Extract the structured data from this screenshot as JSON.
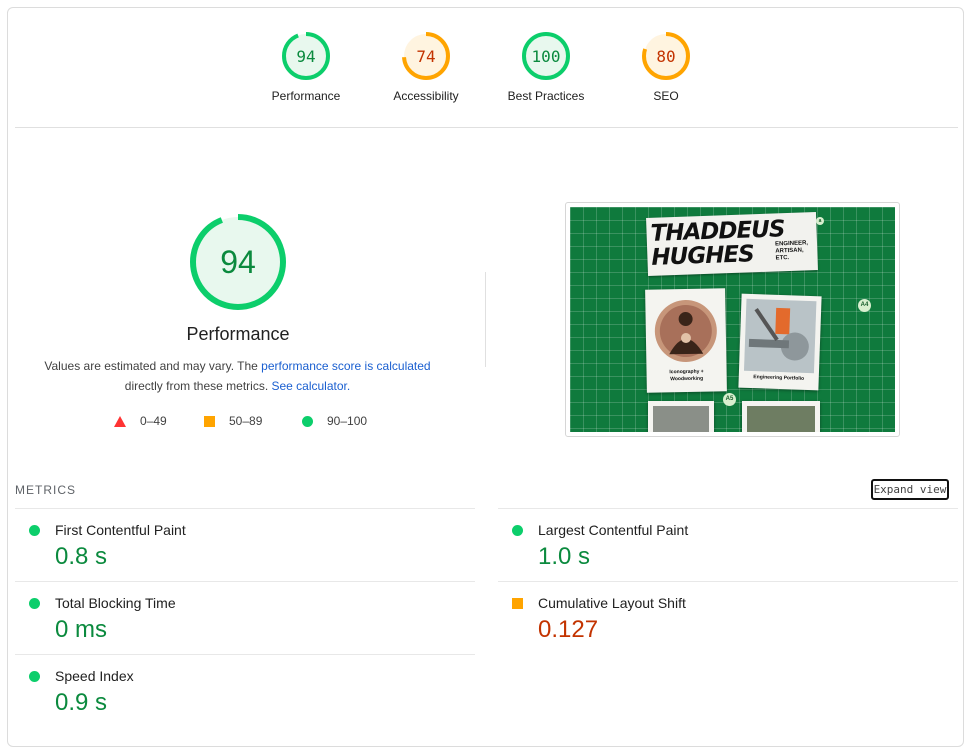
{
  "categories": [
    {
      "label": "Performance",
      "score": "94",
      "value": 94,
      "color": "#0cce6b",
      "text_color": "#0b8a3e",
      "fill": "#e8f8ee"
    },
    {
      "label": "Accessibility",
      "score": "74",
      "value": 74,
      "color": "#ffa400",
      "text_color": "#c33300",
      "fill": "#fff4e0"
    },
    {
      "label": "Best Practices",
      "score": "100",
      "value": 100,
      "color": "#0cce6b",
      "text_color": "#0b8a3e",
      "fill": "#e8f8ee"
    },
    {
      "label": "SEO",
      "score": "80",
      "value": 80,
      "color": "#ffa400",
      "text_color": "#c33300",
      "fill": "#fff4e0"
    }
  ],
  "main": {
    "score": "94",
    "value": 94,
    "title": "Performance",
    "desc_prefix": "Values are estimated and may vary. The ",
    "desc_link": "performance score is calculated",
    "desc_middle": " directly from these metrics. ",
    "calc_link": "See calculator.",
    "legend": {
      "fail": "0–49",
      "average": "50–89",
      "pass": "90–100"
    }
  },
  "screenshot": {
    "name_line1": "THADDEUS",
    "name_line2": "HUGHES",
    "tagline_1": "ENGINEER,",
    "tagline_2": "ARTISAN,",
    "tagline_3": "ETC.",
    "card1_cap_1": "Iconography +",
    "card1_cap_2": "Woodworking",
    "card2_cap": "Engineering Portfolio",
    "badge_a4": "A4",
    "badge_a5": "A5",
    "badge_a3": "a"
  },
  "metrics": {
    "header": "METRICS",
    "expand": "Expand view",
    "items": [
      {
        "name": "First Contentful Paint",
        "value": "0.8 s",
        "status": "pass"
      },
      {
        "name": "Largest Contentful Paint",
        "value": "1.0 s",
        "status": "pass"
      },
      {
        "name": "Total Blocking Time",
        "value": "0 ms",
        "status": "pass"
      },
      {
        "name": "Cumulative Layout Shift",
        "value": "0.127",
        "status": "average"
      },
      {
        "name": "Speed Index",
        "value": "0.9 s",
        "status": "pass"
      }
    ]
  },
  "colors": {
    "pass": "#0cce6b",
    "average": "#ffa400",
    "fail": "#ff3333"
  }
}
